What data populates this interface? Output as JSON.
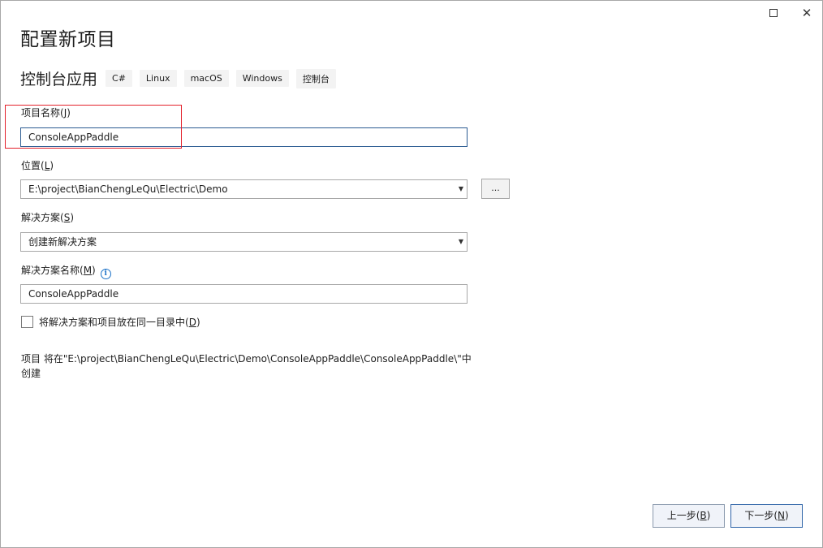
{
  "window": {
    "maximize_icon": "maximize-icon",
    "close_icon": "close-icon",
    "close_glyph": "✕"
  },
  "header": {
    "title": "配置新项目",
    "template_name": "控制台应用",
    "tags": [
      "C#",
      "Linux",
      "macOS",
      "Windows",
      "控制台"
    ]
  },
  "form": {
    "project_name": {
      "label": "项目名称(J)",
      "label_text": "项目名称(",
      "label_key": "J",
      "value": "ConsoleAppPaddle"
    },
    "location": {
      "label": "位置(L)",
      "label_text": "位置(",
      "label_key": "L",
      "value": "E:\\project\\BianChengLeQu\\Electric\\Demo",
      "browse_label": "..."
    },
    "solution": {
      "label": "解决方案(S)",
      "label_text": "解决方案(",
      "label_key": "S",
      "value": "创建新解决方案"
    },
    "solution_name": {
      "label": "解决方案名称(M)",
      "label_text": "解决方案名称(",
      "label_key": "M",
      "value": "ConsoleAppPaddle"
    },
    "same_dir_checkbox": {
      "label": "将解决方案和项目放在同一目录中(D)",
      "label_text": "将解决方案和项目放在同一目录中(",
      "label_key": "D",
      "checked": false
    }
  },
  "note": {
    "line1": "项目 将在\"E:\\project\\BianChengLeQu\\Electric\\Demo\\ConsoleAppPaddle\\ConsoleAppPaddle\\\"中",
    "line2": "创建"
  },
  "footer": {
    "back_label": "上一步(B)",
    "back_text": "上一步(",
    "back_key": "B",
    "next_label": "下一步(N)",
    "next_text": "下一步(",
    "next_key": "N"
  },
  "colors": {
    "highlight_box": "#e3212b",
    "accent": "#2b5b92",
    "info_icon": "#1e73c8"
  }
}
